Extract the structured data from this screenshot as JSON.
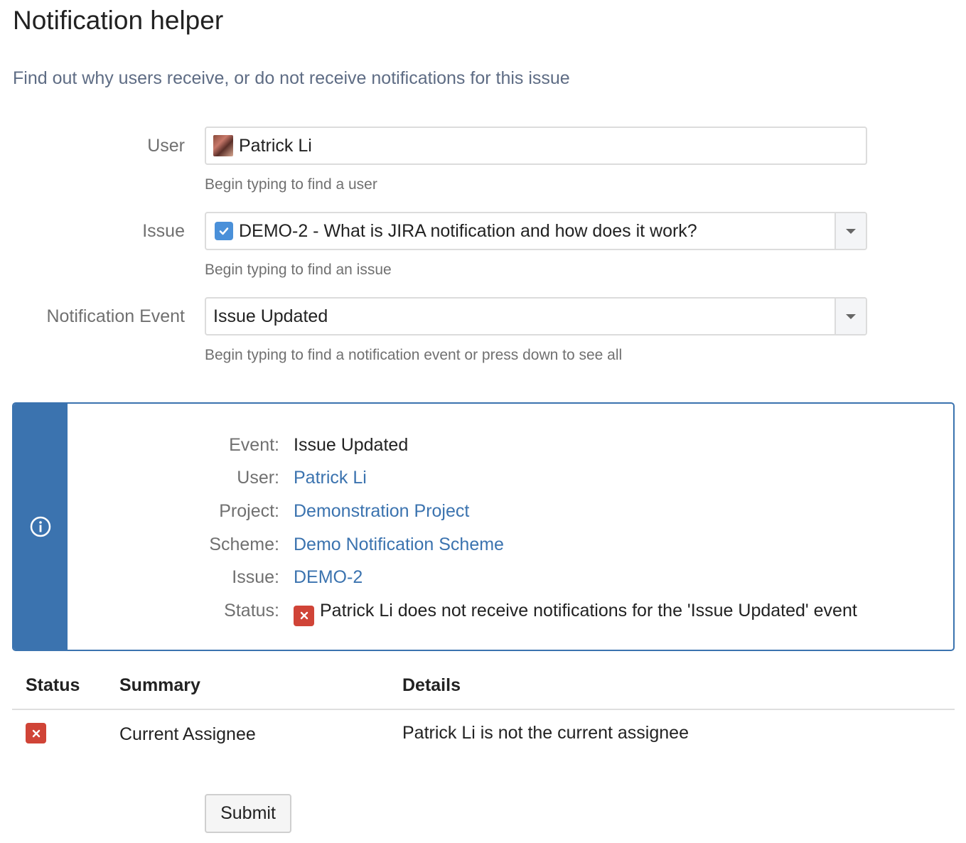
{
  "page": {
    "title": "Notification helper",
    "description": "Find out why users receive, or do not receive notifications for this issue"
  },
  "form": {
    "user": {
      "label": "User",
      "value": "Patrick Li",
      "help": "Begin typing to find a user",
      "icon": "user-avatar"
    },
    "issue": {
      "label": "Issue",
      "value": "DEMO-2 - What is JIRA notification and how does it work?",
      "help": "Begin typing to find an issue",
      "icon": "task-checkbox-icon"
    },
    "event": {
      "label": "Notification Event",
      "value": "Issue Updated",
      "help": "Begin typing to find a notification event or press down to see all"
    }
  },
  "result": {
    "icon": "info-icon",
    "rows": {
      "event": {
        "key": "Event:",
        "value": "Issue Updated"
      },
      "user": {
        "key": "User:",
        "value": "Patrick Li"
      },
      "project": {
        "key": "Project:",
        "value": "Demonstration Project"
      },
      "scheme": {
        "key": "Scheme:",
        "value": "Demo Notification Scheme"
      },
      "issue": {
        "key": "Issue:",
        "value": "DEMO-2"
      },
      "status": {
        "key": "Status:",
        "value": "Patrick Li does not receive notifications for the 'Issue Updated' event"
      }
    },
    "colors": {
      "accent": "#3b73af",
      "error": "#d04437"
    }
  },
  "table": {
    "headers": {
      "status": "Status",
      "summary": "Summary",
      "details": "Details"
    },
    "rows": [
      {
        "status": "fail",
        "summary": "Current Assignee",
        "details": "Patrick Li is not the current assignee"
      }
    ]
  },
  "actions": {
    "submit_label": "Submit"
  }
}
